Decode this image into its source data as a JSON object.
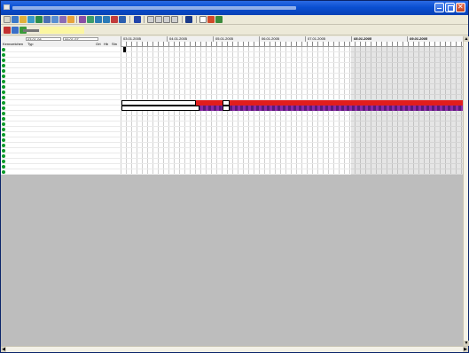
{
  "window": {
    "controls": {
      "minimize": "minimize",
      "maximize": "maximize",
      "close": "close"
    }
  },
  "toolbar1": {
    "icons": [
      "new-icon",
      "open-icon",
      "save-icon",
      "print-icon",
      "calendar-icon",
      "search-icon",
      "zoom-icon",
      "grid-icon",
      "arrow-left-icon",
      "arrow-right-icon",
      "first-icon",
      "prev-icon",
      "next-icon",
      "last-icon",
      "square-icon",
      "window-icon",
      "tree-icon"
    ]
  },
  "toolbar2": {},
  "columns": {
    "selector_left": "03.01.08",
    "selector_right": "09.01.07",
    "headers": [
      "Kennzeichen",
      "Typ",
      "Ort",
      "Hb",
      "Stn"
    ]
  },
  "dates": [
    "03.01.2005",
    "04.01.2005",
    "05.01.2005",
    "06.01.2005",
    "07.01.2005",
    "08.01.2005",
    "09.01.2005"
  ],
  "rows": [
    {},
    {},
    {},
    {},
    {},
    {},
    {},
    {},
    {},
    {},
    {},
    {},
    {},
    {},
    {},
    {},
    {},
    {},
    {},
    {},
    {},
    {},
    {},
    {}
  ],
  "bars": [
    {},
    {}
  ],
  "colors": {
    "titlebar": "#0a4fd1",
    "bar_red": "#e11d1d",
    "bar_purple": "#5a1a7a",
    "status_dot": "#0a9a2a"
  }
}
